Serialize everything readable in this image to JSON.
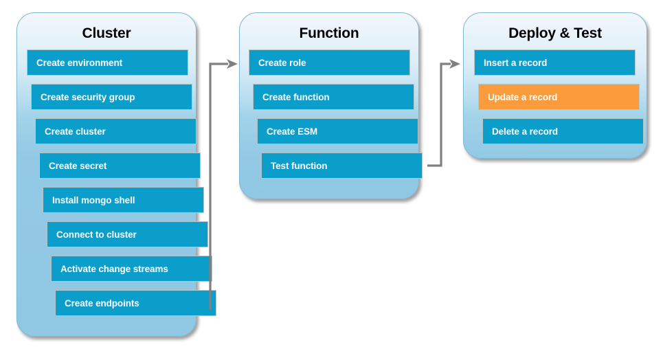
{
  "diagram": {
    "type": "flow-columns",
    "title": "",
    "accent_blue": "#0c9ecb",
    "accent_orange": "#fb9c3c",
    "panel_top_color": "#f2f8fc",
    "panel_bottom_color": "#90c8e3",
    "connector_color": "#808080",
    "columns": [
      {
        "id": "cluster",
        "title": "Cluster",
        "steps": [
          {
            "label": "Create environment",
            "state": "default"
          },
          {
            "label": "Create security group",
            "state": "default"
          },
          {
            "label": "Create cluster",
            "state": "default"
          },
          {
            "label": "Create secret",
            "state": "default"
          },
          {
            "label": "Install mongo shell",
            "state": "default"
          },
          {
            "label": "Connect to cluster",
            "state": "default"
          },
          {
            "label": "Activate change streams",
            "state": "default"
          },
          {
            "label": "Create endpoints",
            "state": "default"
          }
        ]
      },
      {
        "id": "function",
        "title": "Function",
        "steps": [
          {
            "label": "Create role",
            "state": "default"
          },
          {
            "label": "Create function",
            "state": "default"
          },
          {
            "label": "Create ESM",
            "state": "default"
          },
          {
            "label": "Test function",
            "state": "default"
          }
        ]
      },
      {
        "id": "deploy-test",
        "title": "Deploy & Test",
        "steps": [
          {
            "label": "Insert a record",
            "state": "default"
          },
          {
            "label": "Update a record",
            "state": "highlighted"
          },
          {
            "label": "Delete a record",
            "state": "default"
          }
        ]
      }
    ],
    "connectors": [
      {
        "id": "cluster-to-function",
        "from": "cluster",
        "to": "function"
      },
      {
        "id": "function-to-deploy-test",
        "from": "function",
        "to": "deploy-test"
      }
    ]
  }
}
